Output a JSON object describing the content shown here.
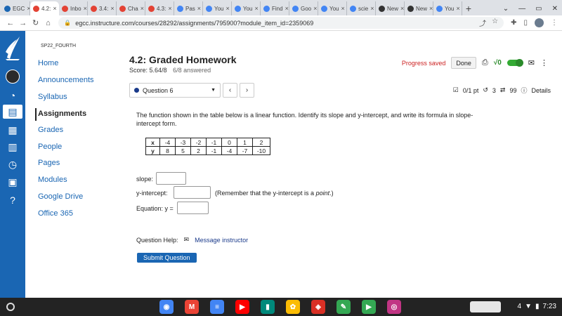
{
  "tabs": [
    {
      "label": "EGC",
      "color": "#1a66b3"
    },
    {
      "label": "4.2:",
      "color": "#e34234",
      "active": true
    },
    {
      "label": "Inbo",
      "color": "#e34234"
    },
    {
      "label": "3.4:",
      "color": "#e34234"
    },
    {
      "label": "Cha",
      "color": "#e34234"
    },
    {
      "label": "4.3:",
      "color": "#e34234"
    },
    {
      "label": "Pas",
      "color": "#4285f4"
    },
    {
      "label": "You",
      "color": "#4285f4"
    },
    {
      "label": "You",
      "color": "#4285f4"
    },
    {
      "label": "Find",
      "color": "#4285f4"
    },
    {
      "label": "Goo",
      "color": "#4285f4"
    },
    {
      "label": "You",
      "color": "#4285f4"
    },
    {
      "label": "scie",
      "color": "#4285f4"
    },
    {
      "label": "New",
      "color": "#333333"
    },
    {
      "label": "New",
      "color": "#333333"
    },
    {
      "label": "You",
      "color": "#4285f4"
    }
  ],
  "url": "egcc.instructure.com/courses/28292/assignments/795900?module_item_id=2359069",
  "course_code": "SP22_FOURTH",
  "course_nav": [
    "Home",
    "Announcements",
    "Syllabus",
    "Assignments",
    "Grades",
    "People",
    "Pages",
    "Modules",
    "Google Drive",
    "Office 365"
  ],
  "active_nav": "Assignments",
  "header": {
    "title": "4.2: Graded Homework",
    "score": "Score: 5.64/8",
    "answered": "6/8 answered",
    "progress": "Progress saved",
    "done": "Done"
  },
  "question_bar": {
    "select": "Question 6",
    "points": "0/1 pt",
    "retries": "3",
    "attempts": "99",
    "details": "Details"
  },
  "question": {
    "prompt": "The function shown in the table below is a linear function. Identify its slope and y-intercept, and write its formula in slope-intercept form.",
    "table": {
      "x": [
        "x",
        "-4",
        "-3",
        "-2",
        "-1",
        "0",
        "1",
        "2"
      ],
      "y": [
        "y",
        "8",
        "5",
        "2",
        "-1",
        "-4",
        "-7",
        "-10"
      ]
    },
    "slope_label": "slope:",
    "yint_label": "y-intercept:",
    "note_prefix": "(Remember that the y-intercept is a ",
    "note_em": "point",
    "note_suffix": ".)",
    "eq_label": "Equation: y ="
  },
  "help": {
    "label": "Question Help:",
    "link": "Message instructor"
  },
  "submit": "Submit Question",
  "shelf_apps": [
    {
      "name": "chrome",
      "color": "#4285f4"
    },
    {
      "name": "gmail",
      "color": "#ea4335"
    },
    {
      "name": "docs",
      "color": "#4285f4"
    },
    {
      "name": "youtube",
      "color": "#ff0000"
    },
    {
      "name": "meet",
      "color": "#00897b"
    },
    {
      "name": "photos",
      "color": "#fbbc04"
    },
    {
      "name": "app-red",
      "color": "#d93025"
    },
    {
      "name": "app-green",
      "color": "#34a853"
    },
    {
      "name": "play-store",
      "color": "#34a853"
    },
    {
      "name": "instagram",
      "color": "#c13584"
    }
  ],
  "time": "7:23",
  "notif_count": "4"
}
